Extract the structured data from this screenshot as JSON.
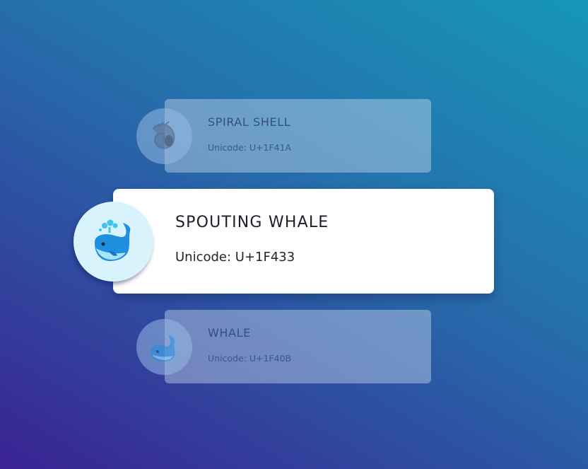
{
  "cards": [
    {
      "title": "SPIRAL SHELL",
      "code": "Unicode: U+1F41A",
      "icon": "spiral-shell-icon",
      "state": "faded"
    },
    {
      "title": "SPOUTING WHALE",
      "code": "Unicode: U+1F433",
      "icon": "spouting-whale-icon",
      "state": "active"
    },
    {
      "title": "WHALE",
      "code": "Unicode: U+1F40B",
      "icon": "whale-icon",
      "state": "faded"
    }
  ],
  "colors": {
    "accent_blue": "#1f8fe0",
    "active_circle": "#d8f3fb",
    "card_active_bg": "#ffffff"
  }
}
